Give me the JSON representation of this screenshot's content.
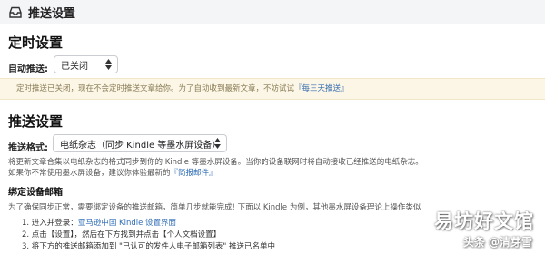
{
  "header": {
    "title": "推送设置",
    "icon": "inbox-icon"
  },
  "timed": {
    "heading": "定时设置",
    "label": "自动推送:",
    "select_value": "已关闭",
    "notice_text": "定时推送已关闭，现在不会定时推送文章给你。为了自动收到最新文章，不妨试试",
    "notice_link": "『每三天推送』"
  },
  "push": {
    "heading": "推送设置",
    "format_label": "推送格式:",
    "format_value": "电纸杂志（同步 Kindle 等墨水屏设备）",
    "desc_line1": "将更新文章合集以电纸杂志的格式同步到你的 Kindle 等墨水屏设备。当你的设备联网时将自动接收已经推送的电纸杂志。",
    "desc_line2_prefix": "如果你不常使用墨水屏设备，建议你体验最新的",
    "desc_line2_link": "『简报邮件』"
  },
  "bind": {
    "heading": "绑定设备邮箱",
    "intro": "为了确保同步正常，需要绑定设备的推送邮箱，简单几步就能完成! 下面以 Kindle 为例，其他墨水屏设备理论上操作类似",
    "step1_prefix": "1. 进入并登录：",
    "step1_link": "亚马逊中国 Kindle 设置界面",
    "step2": "2. 点击【设置】，然后在下方找到并点击【个人文档设置】",
    "step3": "3. 将下方的推送邮箱添加到 \"已认可的发件人电子邮箱列表\" 推送已名单中"
  },
  "watermark": {
    "big": "易坊好文馆",
    "small": "头条 @清芽雪"
  }
}
